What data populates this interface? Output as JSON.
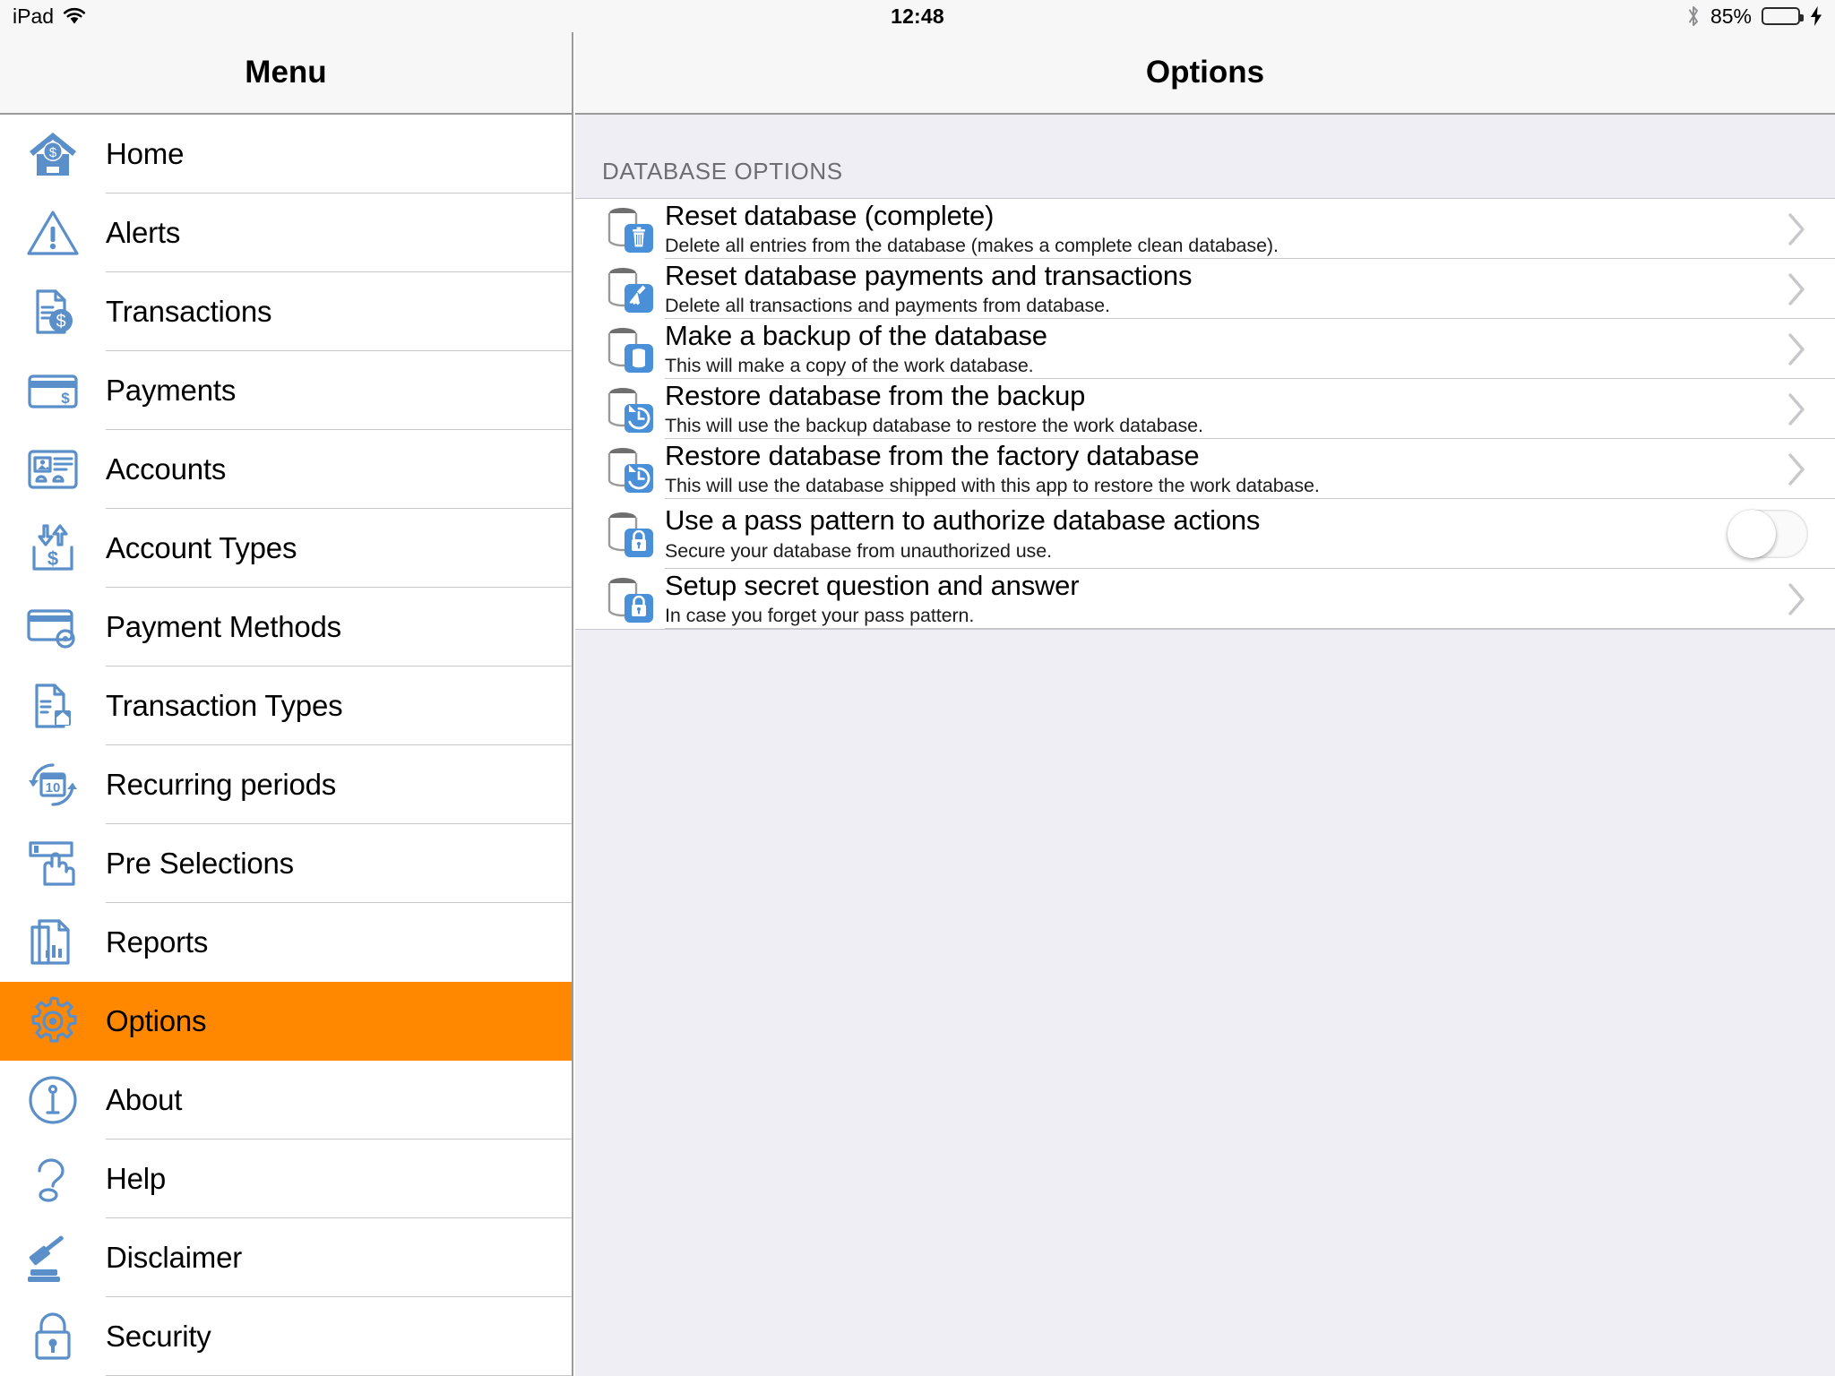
{
  "status_bar": {
    "carrier": "iPad",
    "wifi_icon": "wifi-icon",
    "time": "12:48",
    "bluetooth_icon": "bluetooth-icon",
    "battery_percent": "85%",
    "battery_level": 85,
    "charging_icon": "lightning-bolt-icon",
    "battery_color": "#4cd964"
  },
  "sidebar": {
    "title": "Menu",
    "active_color": "#FF8800",
    "icon_color": "#5B8FC9",
    "items": [
      {
        "label": "Home",
        "icon": "house-dollar-icon",
        "active": false
      },
      {
        "label": "Alerts",
        "icon": "warning-triangle-icon",
        "active": false
      },
      {
        "label": "Transactions",
        "icon": "document-dollar-icon",
        "active": false
      },
      {
        "label": "Payments",
        "icon": "credit-card-dollar-icon",
        "active": false
      },
      {
        "label": "Accounts",
        "icon": "id-card-icon",
        "active": false
      },
      {
        "label": "Account Types",
        "icon": "arrows-dollar-icon",
        "active": false
      },
      {
        "label": "Payment Methods",
        "icon": "credit-card-gear-icon",
        "active": false
      },
      {
        "label": "Transaction Types",
        "icon": "document-house-icon",
        "active": false
      },
      {
        "label": "Recurring periods",
        "icon": "calendar-refresh-icon",
        "active": false
      },
      {
        "label": "Pre Selections",
        "icon": "hand-tap-icon",
        "active": false
      },
      {
        "label": "Reports",
        "icon": "document-chart-icon",
        "active": false
      },
      {
        "label": "Options",
        "icon": "gear-icon",
        "active": true
      },
      {
        "label": "About",
        "icon": "info-circle-icon",
        "active": false
      },
      {
        "label": "Help",
        "icon": "question-mark-icon",
        "active": false
      },
      {
        "label": "Disclaimer",
        "icon": "gavel-icon",
        "active": false
      },
      {
        "label": "Security",
        "icon": "padlock-icon",
        "active": false
      }
    ]
  },
  "main": {
    "title": "Options",
    "section_header": "DATABASE OPTIONS",
    "rows": [
      {
        "title": "Reset database (complete)",
        "subtitle": "Delete all entries from the database (makes a complete clean database).",
        "icon": "database-trash-icon",
        "accessory": "chevron-right-icon"
      },
      {
        "title": "Reset database payments and transactions",
        "subtitle": "Delete all transactions and payments from database.",
        "icon": "database-broom-icon",
        "accessory": "chevron-right-icon"
      },
      {
        "title": "Make a backup of the database",
        "subtitle": "This will make a copy of the work database.",
        "icon": "database-copy-icon",
        "accessory": "chevron-right-icon"
      },
      {
        "title": "Restore database from the backup",
        "subtitle": "This will use the backup database to restore the work database.",
        "icon": "database-restore-icon",
        "accessory": "chevron-right-icon"
      },
      {
        "title": "Restore database from the factory database",
        "subtitle": "This will use the database shipped with this app to restore the work database.",
        "icon": "database-restore-icon",
        "accessory": "chevron-right-icon"
      },
      {
        "title": "Use a pass pattern to authorize database actions",
        "subtitle": "Secure your database from unauthorized use.",
        "icon": "database-lock-icon",
        "accessory": "toggle-switch",
        "toggle_on": false
      },
      {
        "title": "Setup secret question and answer",
        "subtitle": "In case you forget your pass pattern.",
        "icon": "database-lock-icon",
        "accessory": "chevron-right-icon"
      }
    ]
  }
}
